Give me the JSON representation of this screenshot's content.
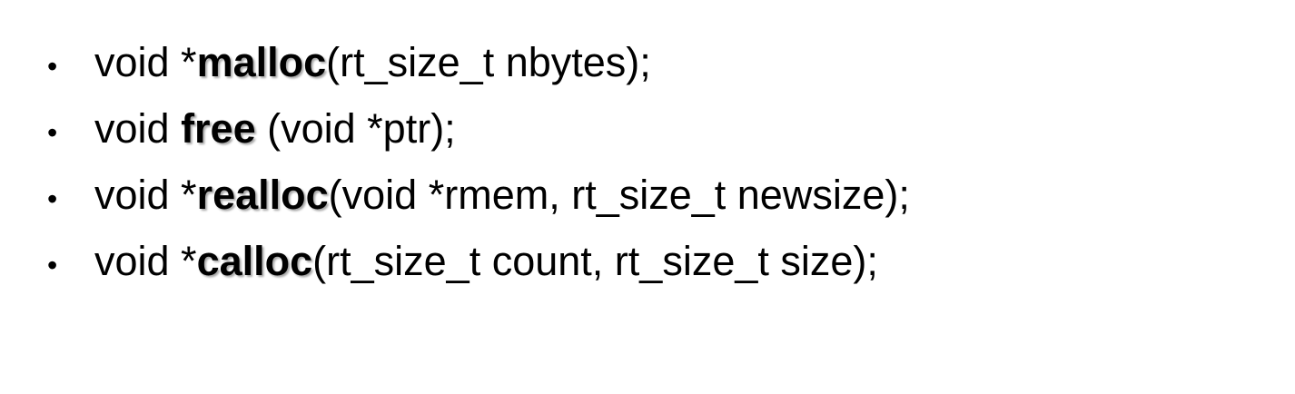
{
  "bullet_symbol": "•",
  "items": [
    {
      "prefix": "void *",
      "name": "malloc",
      "suffix": "(rt_size_t nbytes);"
    },
    {
      "prefix": "void ",
      "name": "free",
      "suffix": " (void *ptr);"
    },
    {
      "prefix": "void *",
      "name": "realloc",
      "suffix": "(void *rmem, rt_size_t newsize);"
    },
    {
      "prefix": "void *",
      "name": "calloc",
      "suffix": "(rt_size_t count, rt_size_t size);"
    }
  ]
}
